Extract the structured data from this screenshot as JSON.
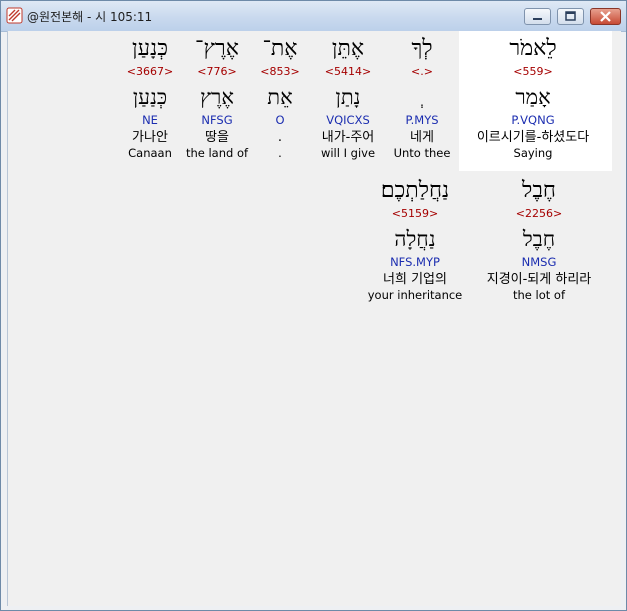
{
  "window": {
    "title": "@원전본해 - 시 105:11"
  },
  "colors": {
    "strong": "#a50000",
    "parsing": "#1b2db0",
    "highlight": "#ffffff"
  },
  "icons": {
    "app": "bible-app-icon",
    "minimize": "minimize-icon",
    "maximize": "maximize-icon",
    "close": "close-icon"
  },
  "row1": [
    {
      "hebrew": "כְּנָעַן",
      "strong": "<3667>",
      "lemma": "כְּנַעַן",
      "parsing": "NE",
      "korean": "가나안",
      "english": "Canaan"
    },
    {
      "hebrew": "אֶרֶץ־",
      "strong": "<776>",
      "lemma": "אֶרֶץ",
      "parsing": "NFSG",
      "korean": "땅을",
      "english": "the land of"
    },
    {
      "hebrew": "אֶת־",
      "strong": "<853>",
      "lemma": "אֵת",
      "parsing": "O",
      "korean": ".",
      "english": "."
    },
    {
      "hebrew": "אֶתֵּן",
      "strong": "<5414>",
      "lemma": "נָתַן",
      "parsing": "VQICXS",
      "korean": "내가-주어",
      "english": "will I give"
    },
    {
      "hebrew": "לְךָ",
      "strong": "<.>",
      "lemma": "ְ",
      "parsing": "P.MYS",
      "korean": "네게",
      "english": "Unto thee"
    },
    {
      "hebrew": "לֵאמֹר",
      "strong": "<559>",
      "lemma": "אָמַר",
      "parsing": "P.VQNG",
      "korean": "이르시기를-하셨도다",
      "english": "Saying"
    }
  ],
  "row2": [
    {
      "hebrew": "נַחֲלַתְכֶם׃",
      "strong": "<5159>",
      "lemma": "נַחֲלָה",
      "parsing": "NFS.MYP",
      "korean": "너희 기업의",
      "english": "your inheritance"
    },
    {
      "hebrew": "חֶבֶל",
      "strong": "<2256>",
      "lemma": "חֶבֶל",
      "parsing": "NMSG",
      "korean": "지경이-되게 하리라",
      "english": "the lot of"
    }
  ]
}
